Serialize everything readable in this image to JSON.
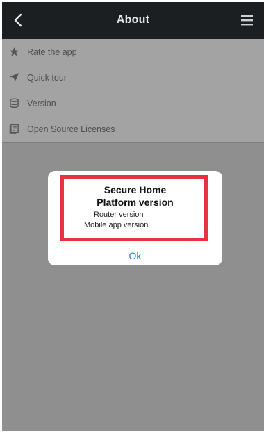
{
  "header": {
    "title": "About",
    "background": "#1c1f22"
  },
  "menu": {
    "items": [
      {
        "label": "Rate the app",
        "icon": "star-icon"
      },
      {
        "label": "Quick tour",
        "icon": "send-icon"
      },
      {
        "label": "Version",
        "icon": "database-icon"
      },
      {
        "label": "Open Source Licenses",
        "icon": "document-icon"
      }
    ]
  },
  "dialog": {
    "title_line1": "Secure Home",
    "title_line2": "Platform version",
    "router_text": "Router version",
    "mobile_text": "Mobile app version",
    "ok_label": "Ok",
    "highlight_color": "#e8333d",
    "ok_color": "#2a7de1"
  }
}
